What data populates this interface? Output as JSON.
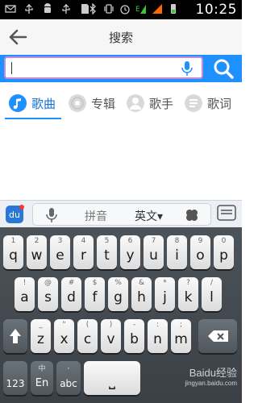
{
  "status_bar": {
    "time": "10:25"
  },
  "header": {
    "title": "搜索"
  },
  "search": {
    "placeholder": ""
  },
  "tabs": [
    {
      "label": "歌曲",
      "icon": "music-note-icon",
      "active": true
    },
    {
      "label": "专辑",
      "icon": "disc-icon",
      "active": false
    },
    {
      "label": "歌手",
      "icon": "singer-icon",
      "active": false
    },
    {
      "label": "歌词",
      "icon": "lyrics-icon",
      "active": false
    }
  ],
  "ime": {
    "pinyin": "拼音",
    "english": "英文▾",
    "logo": "du"
  },
  "keyboard": {
    "row1": [
      {
        "key": "q",
        "sec": "1"
      },
      {
        "key": "w",
        "sec": "2"
      },
      {
        "key": "e",
        "sec": "3"
      },
      {
        "key": "r",
        "sec": "4"
      },
      {
        "key": "t",
        "sec": "5"
      },
      {
        "key": "y",
        "sec": "6"
      },
      {
        "key": "u",
        "sec": "7"
      },
      {
        "key": "i",
        "sec": "8"
      },
      {
        "key": "o",
        "sec": "9"
      },
      {
        "key": "p",
        "sec": "0"
      }
    ],
    "row2": [
      {
        "key": "a",
        "sec": "!"
      },
      {
        "key": "s",
        "sec": "@"
      },
      {
        "key": "d",
        "sec": "#"
      },
      {
        "key": "f",
        "sec": "$"
      },
      {
        "key": "g",
        "sec": "%"
      },
      {
        "key": "h",
        "sec": "&"
      },
      {
        "key": "j",
        "sec": "*"
      },
      {
        "key": "k",
        "sec": "?"
      },
      {
        "key": "l",
        "sec": "/"
      }
    ],
    "row3": [
      {
        "key": "z",
        "sec": "_"
      },
      {
        "key": "x",
        "sec": "\""
      },
      {
        "key": "c",
        "sec": "("
      },
      {
        "key": "v",
        "sec": ")"
      },
      {
        "key": "b",
        "sec": "-"
      },
      {
        "key": "n",
        "sec": ":"
      },
      {
        "key": "m",
        "sec": ";"
      }
    ],
    "row4": {
      "num": "123",
      "lang": "En",
      "lang_sec": "中",
      "abc": "abc",
      "abc_sec": ",",
      "space": "⎵"
    }
  },
  "watermark": {
    "text": "Baidu经验",
    "url": "jingyan.baidu.com"
  },
  "colors": {
    "accent": "#1e90ff",
    "search_border": "#c58bd6",
    "keyboard_bg": "#444a50"
  }
}
